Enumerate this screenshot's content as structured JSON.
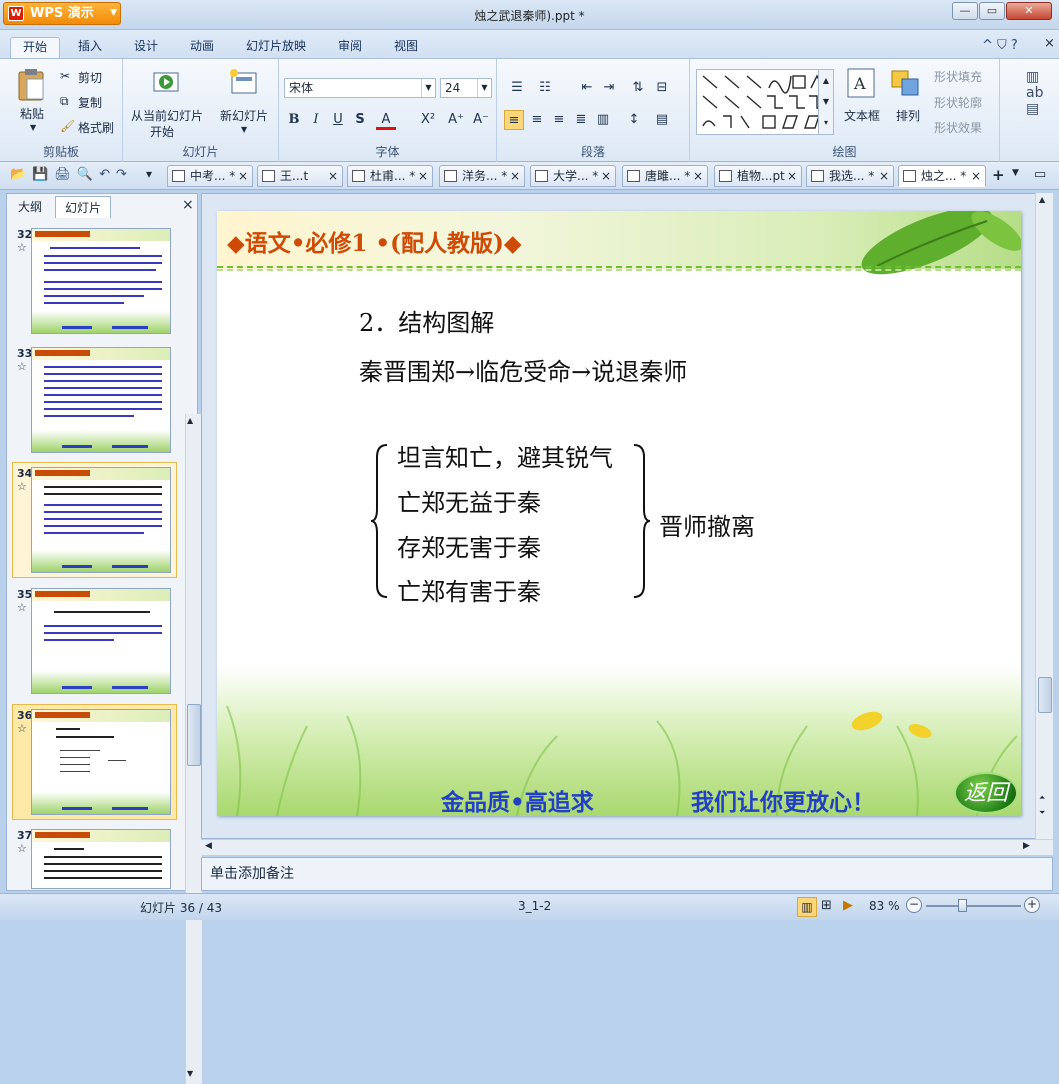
{
  "app": {
    "name": "WPS 演示",
    "logo": "W"
  },
  "window": {
    "title": "烛之武退秦师).ppt *"
  },
  "ribbon_tabs": [
    "开始",
    "插入",
    "设计",
    "动画",
    "幻灯片放映",
    "审阅",
    "视图"
  ],
  "ribbon": {
    "clipboard": {
      "group": "剪贴板",
      "paste": "粘贴",
      "cut": "剪切",
      "copy": "复制",
      "format_painter": "格式刷"
    },
    "slides": {
      "group": "幻灯片",
      "from_current_l1": "从当前幻灯片",
      "from_current_l2": "开始",
      "new_slide": "新幻灯片"
    },
    "font": {
      "group": "字体",
      "font_name": "宋体",
      "font_size": "24"
    },
    "paragraph": {
      "group": "段落"
    },
    "drawing": {
      "group": "绘图",
      "textbox": "文本框",
      "arrange": "排列",
      "shape_fill": "形状填充",
      "shape_outline": "形状轮廓",
      "shape_effects": "形状效果"
    }
  },
  "doc_tabs": [
    "中考... *",
    "王...t",
    "杜甫... *",
    "洋务... *",
    "大学... *",
    "唐雎... *",
    "植物...pt",
    "我选... *",
    "烛之... *"
  ],
  "left_pane": {
    "tab_outline": "大纲",
    "tab_slides": "幻灯片",
    "close": "×",
    "thumbs": [
      {
        "num": "32"
      },
      {
        "num": "33"
      },
      {
        "num": "34"
      },
      {
        "num": "35"
      },
      {
        "num": "36"
      },
      {
        "num": "37"
      }
    ],
    "star": "☆"
  },
  "slide": {
    "header": "◆语文•必修1 •(配人教版)◆",
    "heading": "2．结构图解",
    "flow": "秦晋围郑→临危受命→说退秦师",
    "items": [
      "坦言知亡，避其锐气",
      "亡郑无益于秦",
      "存郑无害于秦",
      "亡郑有害于秦"
    ],
    "result": "晋师撤离",
    "footer_left": "金品质•高追求",
    "footer_right": "我们让你更放心！",
    "return": "返回"
  },
  "notes": {
    "placeholder": "单击添加备注"
  },
  "status": {
    "slide_counter": "幻灯片 36 / 43",
    "template": "3_1-2",
    "zoom": "83 %"
  },
  "colors": {
    "header_text": "#cf4a04",
    "footer_text": "#2140c6",
    "accent": "#f18b07"
  }
}
